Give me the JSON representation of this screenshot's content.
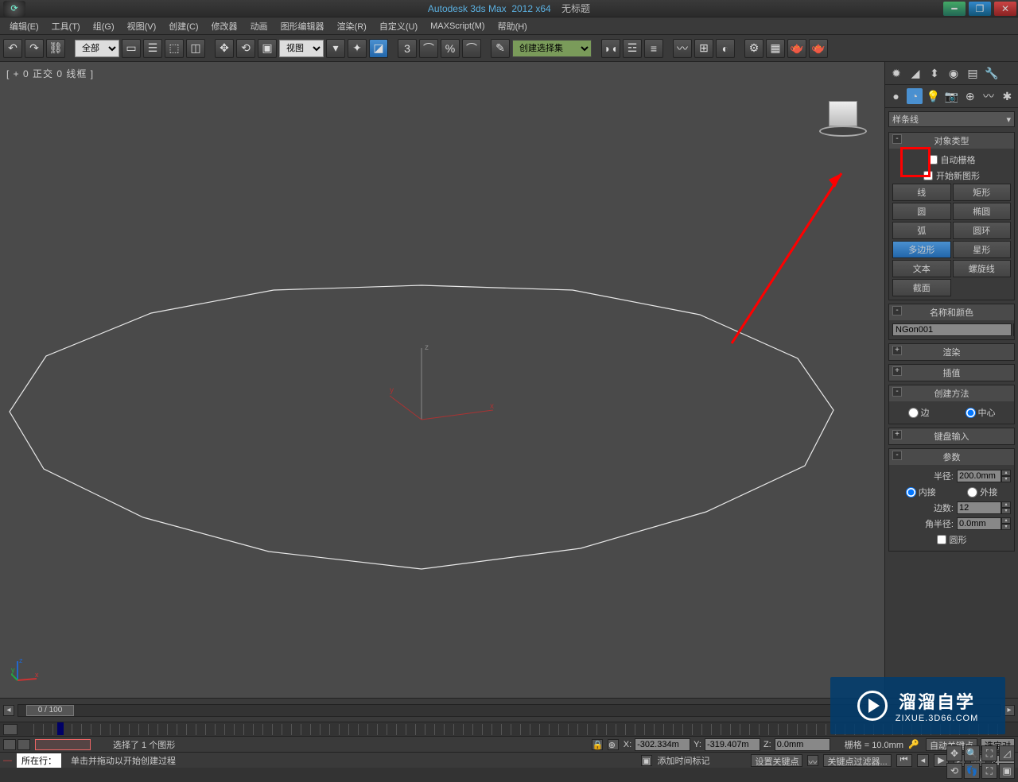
{
  "title": {
    "app": "Autodesk 3ds Max",
    "version": "2012 x64",
    "doc": "无标题"
  },
  "menu": [
    "编辑(E)",
    "工具(T)",
    "组(G)",
    "视图(V)",
    "创建(C)",
    "修改器",
    "动画",
    "图形编辑器",
    "渲染(R)",
    "自定义(U)",
    "MAXScript(M)",
    "帮助(H)"
  ],
  "toolbar": {
    "filter_select": "全部",
    "ref_select": "视图",
    "named_sel": "创建选择集"
  },
  "viewport": {
    "label": "[ + 0 正交 0 线框 ]",
    "gizmo_labels": {
      "x": "x",
      "y": "y",
      "z": "z"
    }
  },
  "panel": {
    "dropdown": "样条线",
    "rollout_object": {
      "title": "对象类型",
      "autogrid": "自动栅格",
      "startnew": "开始新图形"
    },
    "objects": [
      {
        "l": "线",
        "r": "矩形"
      },
      {
        "l": "圆",
        "r": "椭圆"
      },
      {
        "l": "弧",
        "r": "圆环"
      },
      {
        "l": "多边形",
        "r": "星形",
        "l_sel": true
      },
      {
        "l": "文本",
        "r": "螺旋线"
      },
      {
        "l": "截面",
        "r": ""
      }
    ],
    "rollout_name": {
      "title": "名称和颜色",
      "value": "NGon001"
    },
    "rollout_render": "渲染",
    "rollout_interp": "插值",
    "rollout_method": {
      "title": "创建方法",
      "edge": "边",
      "center": "中心"
    },
    "rollout_kbd": "键盘输入",
    "rollout_params": {
      "title": "参数",
      "radius_lbl": "半径:",
      "radius_val": "200.0mm",
      "inscribe": "内接",
      "circum": "外接",
      "sides_lbl": "边数:",
      "sides_val": "12",
      "corner_lbl": "角半径:",
      "corner_val": "0.0mm",
      "circular": "圆形"
    }
  },
  "timeline": {
    "pos": "0 / 100"
  },
  "status": {
    "selected": "选择了 1 个图形",
    "x_lbl": "X:",
    "x_val": "-302.334m",
    "y_lbl": "Y:",
    "y_val": "-319.407m",
    "z_lbl": "Z:",
    "z_val": "0.0mm",
    "grid": "栅格 = 10.0mm",
    "autokey": "自动关键点",
    "selkey": "选定对",
    "setkey": "设置关键点",
    "keyfilter": "关键点过滤器...",
    "frame": "0",
    "locate": "所在行：",
    "prompt": "单击并拖动以开始创建过程",
    "addmarker": "添加时间标记"
  },
  "watermark": {
    "cn": "溜溜自学",
    "en": "ZIXUE.3D66.COM"
  }
}
